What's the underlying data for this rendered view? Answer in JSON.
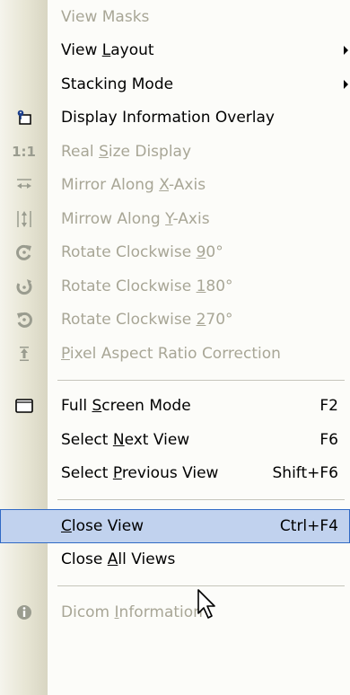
{
  "menu": {
    "items": [
      {
        "type": "item",
        "label_before": "View Masks",
        "mnemonic": "",
        "label_after": "",
        "shortcut": "",
        "submenu": false,
        "disabled": true,
        "icon": ""
      },
      {
        "type": "item",
        "label_before": "View ",
        "mnemonic": "L",
        "label_after": "ayout",
        "shortcut": "",
        "submenu": true,
        "disabled": false,
        "icon": ""
      },
      {
        "type": "item",
        "label_before": "Stacking Mode",
        "mnemonic": "",
        "label_after": "",
        "shortcut": "",
        "submenu": true,
        "disabled": false,
        "icon": ""
      },
      {
        "type": "item",
        "label_before": "Display Information Overlay",
        "mnemonic": "",
        "label_after": "",
        "shortcut": "",
        "submenu": false,
        "disabled": false,
        "icon": "info-overlay-icon"
      },
      {
        "type": "item",
        "label_before": "Real ",
        "mnemonic": "S",
        "label_after": "ize Display",
        "shortcut": "",
        "submenu": false,
        "disabled": true,
        "icon": "real-size-icon",
        "icon_text": "1:1"
      },
      {
        "type": "item",
        "label_before": "Mirror Along ",
        "mnemonic": "X",
        "label_after": "-Axis",
        "shortcut": "",
        "submenu": false,
        "disabled": true,
        "icon": "mirror-x-icon"
      },
      {
        "type": "item",
        "label_before": "Mirrow Along ",
        "mnemonic": "Y",
        "label_after": "-Axis",
        "shortcut": "",
        "submenu": false,
        "disabled": true,
        "icon": "mirror-y-icon"
      },
      {
        "type": "item",
        "label_before": "Rotate Clockwise ",
        "mnemonic": "9",
        "label_after": "0°",
        "shortcut": "",
        "submenu": false,
        "disabled": true,
        "icon": "rotate-90-icon"
      },
      {
        "type": "item",
        "label_before": "Rotate Clockwise ",
        "mnemonic": "1",
        "label_after": "80°",
        "shortcut": "",
        "submenu": false,
        "disabled": true,
        "icon": "rotate-180-icon"
      },
      {
        "type": "item",
        "label_before": "Rotate Clockwise ",
        "mnemonic": "2",
        "label_after": "70°",
        "shortcut": "",
        "submenu": false,
        "disabled": true,
        "icon": "rotate-270-icon"
      },
      {
        "type": "item",
        "label_before": "",
        "mnemonic": "P",
        "label_after": "ixel Aspect Ratio Correction",
        "shortcut": "",
        "submenu": false,
        "disabled": true,
        "icon": "pixel-aspect-icon"
      },
      {
        "type": "separator"
      },
      {
        "type": "item",
        "label_before": "Full ",
        "mnemonic": "S",
        "label_after": "creen Mode",
        "shortcut": "F2",
        "submenu": false,
        "disabled": false,
        "icon": "fullscreen-icon"
      },
      {
        "type": "item",
        "label_before": "Select ",
        "mnemonic": "N",
        "label_after": "ext View",
        "shortcut": "F6",
        "submenu": false,
        "disabled": false,
        "icon": ""
      },
      {
        "type": "item",
        "label_before": "Select ",
        "mnemonic": "P",
        "label_after": "revious View",
        "shortcut": "Shift+F6",
        "submenu": false,
        "disabled": false,
        "icon": ""
      },
      {
        "type": "separator"
      },
      {
        "type": "item",
        "label_before": "",
        "mnemonic": "C",
        "label_after": "lose View",
        "shortcut": "Ctrl+F4",
        "submenu": false,
        "disabled": false,
        "selected": true,
        "icon": ""
      },
      {
        "type": "item",
        "label_before": "Close ",
        "mnemonic": "A",
        "label_after": "ll Views",
        "shortcut": "",
        "submenu": false,
        "disabled": false,
        "icon": ""
      },
      {
        "type": "separator"
      },
      {
        "type": "item",
        "label_before": "Dicom ",
        "mnemonic": "I",
        "label_after": "nformation",
        "shortcut": "",
        "submenu": false,
        "disabled": true,
        "icon": "dicom-info-icon"
      }
    ]
  },
  "colors": {
    "disabled_text": "#a8a696",
    "selection_bg": "#c1d2ee",
    "selection_border": "#316ac5",
    "gutter": "#e7e5d4"
  }
}
